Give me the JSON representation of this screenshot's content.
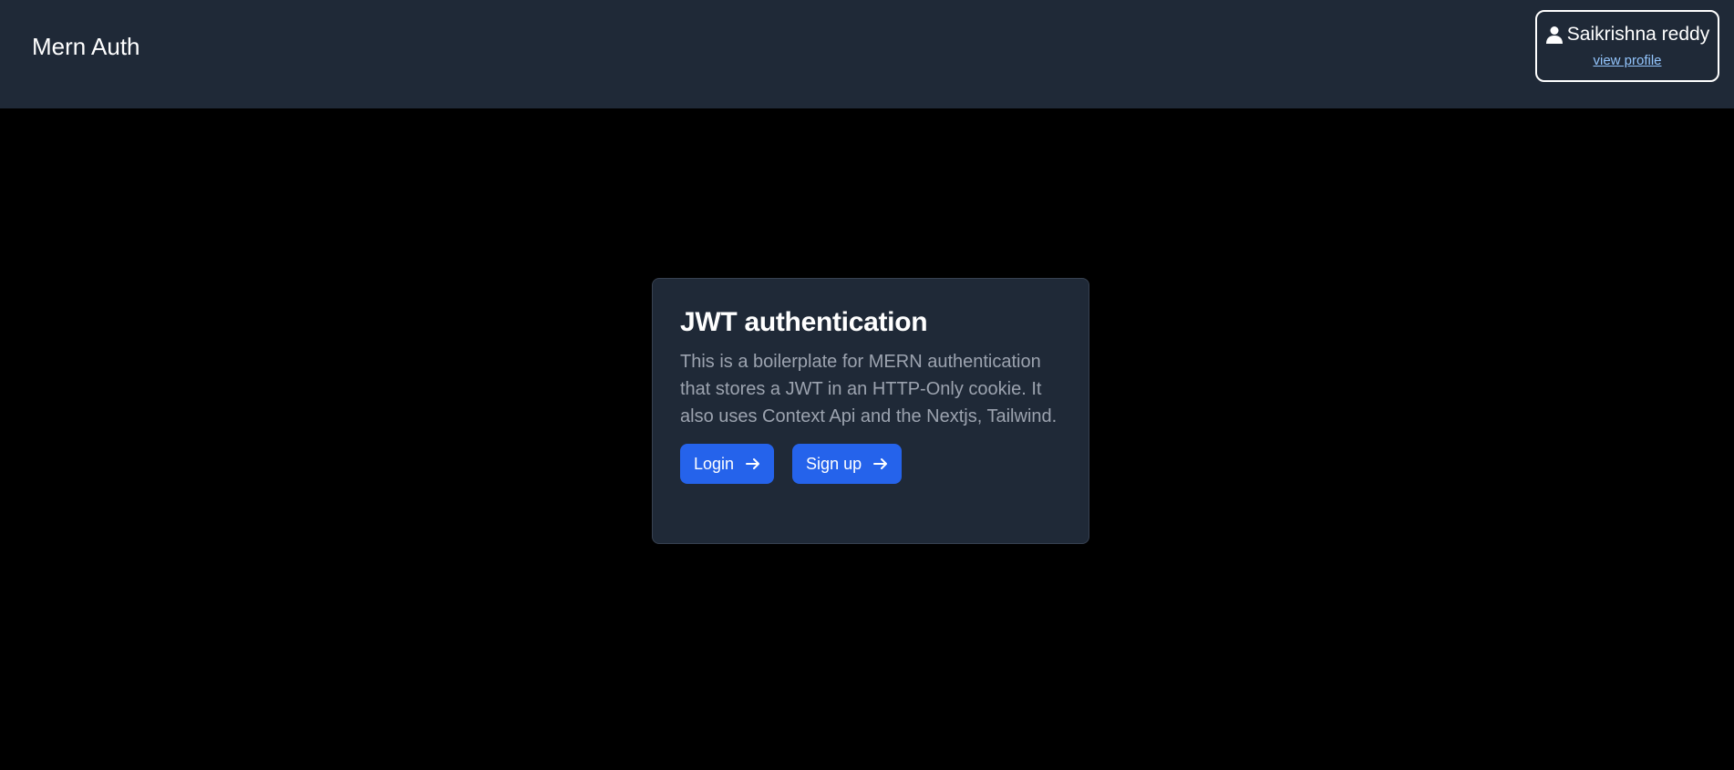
{
  "navbar": {
    "brand": "Mern Auth",
    "user": {
      "name": "Saikrishna reddy",
      "profile_link": "view profile",
      "icon": "user-icon"
    }
  },
  "card": {
    "title": "JWT authentication",
    "description": "This is a boilerplate for MERN authentication that stores a JWT in an HTTP-Only cookie. It also uses Context Api and the Nextjs, Tailwind.",
    "buttons": [
      {
        "label": "Login",
        "icon": "arrow-right-icon"
      },
      {
        "label": "Sign up",
        "icon": "arrow-right-icon"
      }
    ]
  },
  "colors": {
    "navbar_bg": "#1f2937",
    "page_bg": "#000000",
    "card_bg": "#1f2937",
    "button_bg": "#2563eb",
    "link": "#93c5fd",
    "description_text": "#9ca3af"
  }
}
